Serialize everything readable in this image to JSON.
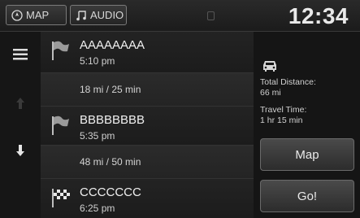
{
  "topbar": {
    "tabs": [
      {
        "label": "MAP",
        "icon": "compass-icon"
      },
      {
        "label": "AUDIO",
        "icon": "music-note-icon"
      }
    ],
    "clock": "12:34"
  },
  "route": {
    "items": [
      {
        "type": "destination",
        "name": "AAAAAAAA",
        "time": "5:10 pm",
        "icon": "flag-icon"
      },
      {
        "type": "leg",
        "text": "18 mi / 25 min"
      },
      {
        "type": "destination",
        "name": "BBBBBBBB",
        "time": "5:35 pm",
        "icon": "flag-icon"
      },
      {
        "type": "leg",
        "text": "48 mi / 50 min"
      },
      {
        "type": "destination",
        "name": "CCCCCCC",
        "time": "6:25 pm",
        "icon": "checkered-flag-icon"
      }
    ]
  },
  "summary": {
    "icon": "car-icon",
    "total_distance_label": "Total Distance:",
    "total_distance_value": "66 mi",
    "travel_time_label": "Travel Time:",
    "travel_time_value": "1 hr 15 min"
  },
  "buttons": {
    "map_label": "Map",
    "go_label": "Go!"
  }
}
